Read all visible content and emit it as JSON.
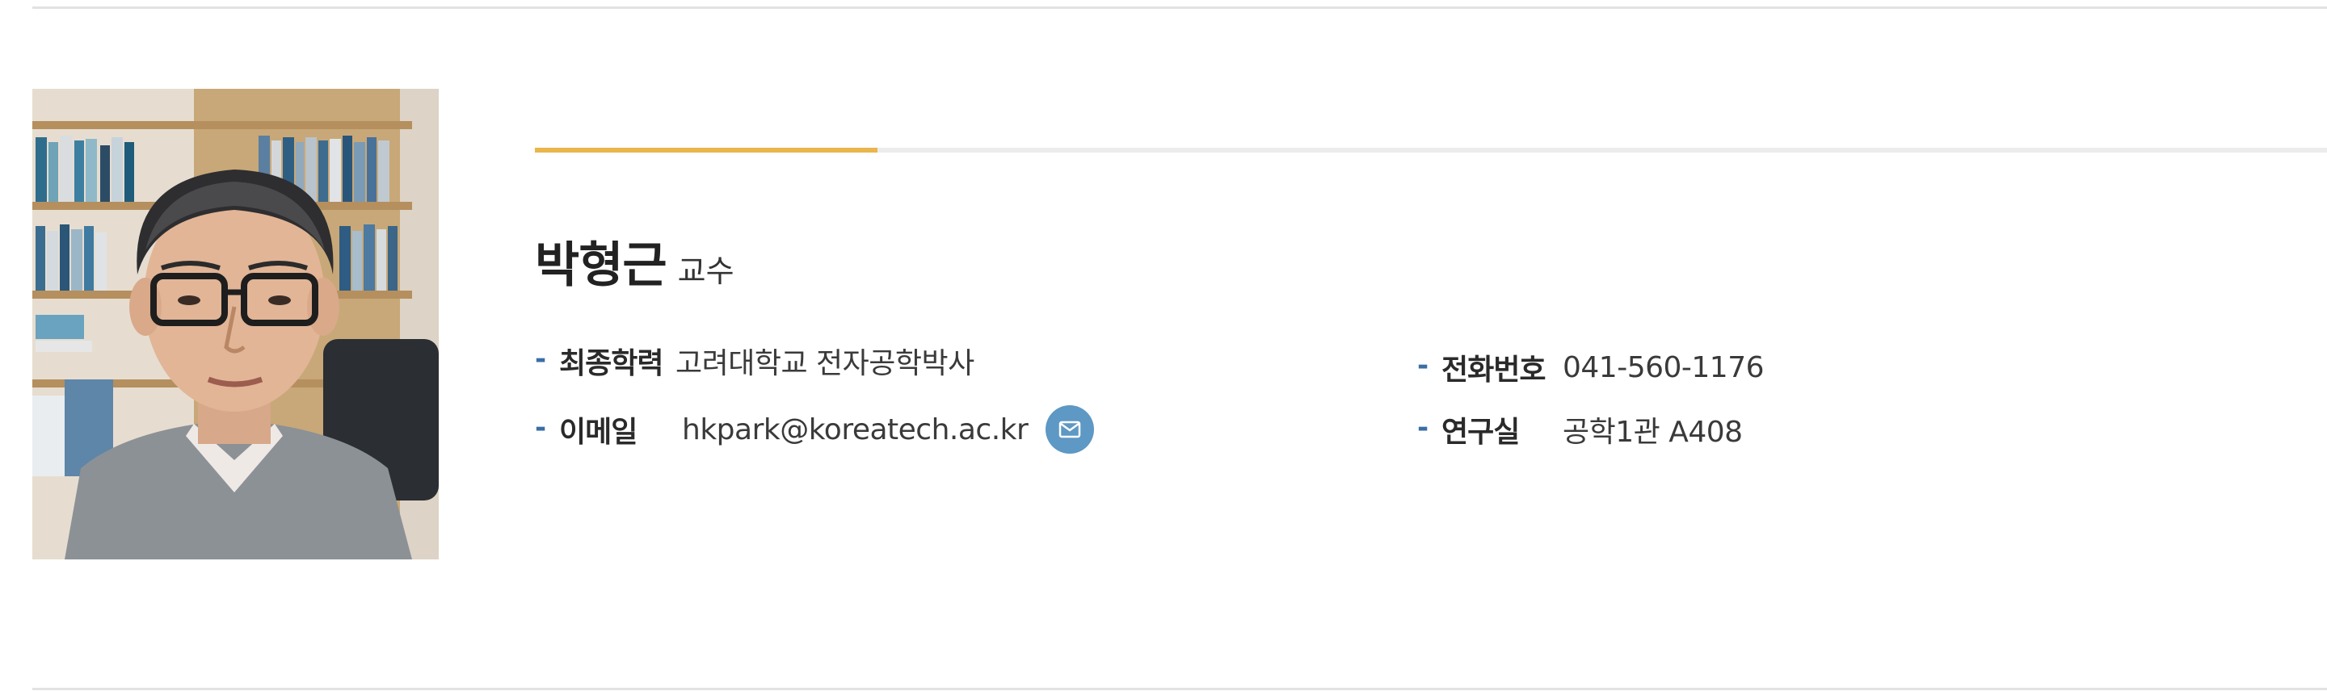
{
  "colors": {
    "accent": "#e8b64c",
    "dash": "#3a6ea5",
    "mail_button": "#5e98c4",
    "rule": "#e2e2e2"
  },
  "profile": {
    "name": "박형근",
    "position": "교수",
    "photo_icon": "professor-portrait-photo"
  },
  "fields": {
    "degree": {
      "label": "최종학력",
      "value": "고려대학교 전자공학박사"
    },
    "email": {
      "label": "이메일",
      "value": "hkpark@koreatech.ac.kr",
      "icon": "mail-icon"
    },
    "phone": {
      "label": "전화번호",
      "value": "041-560-1176"
    },
    "office": {
      "label": "연구실",
      "value": "공학1관 A408"
    }
  },
  "bullet": "-"
}
